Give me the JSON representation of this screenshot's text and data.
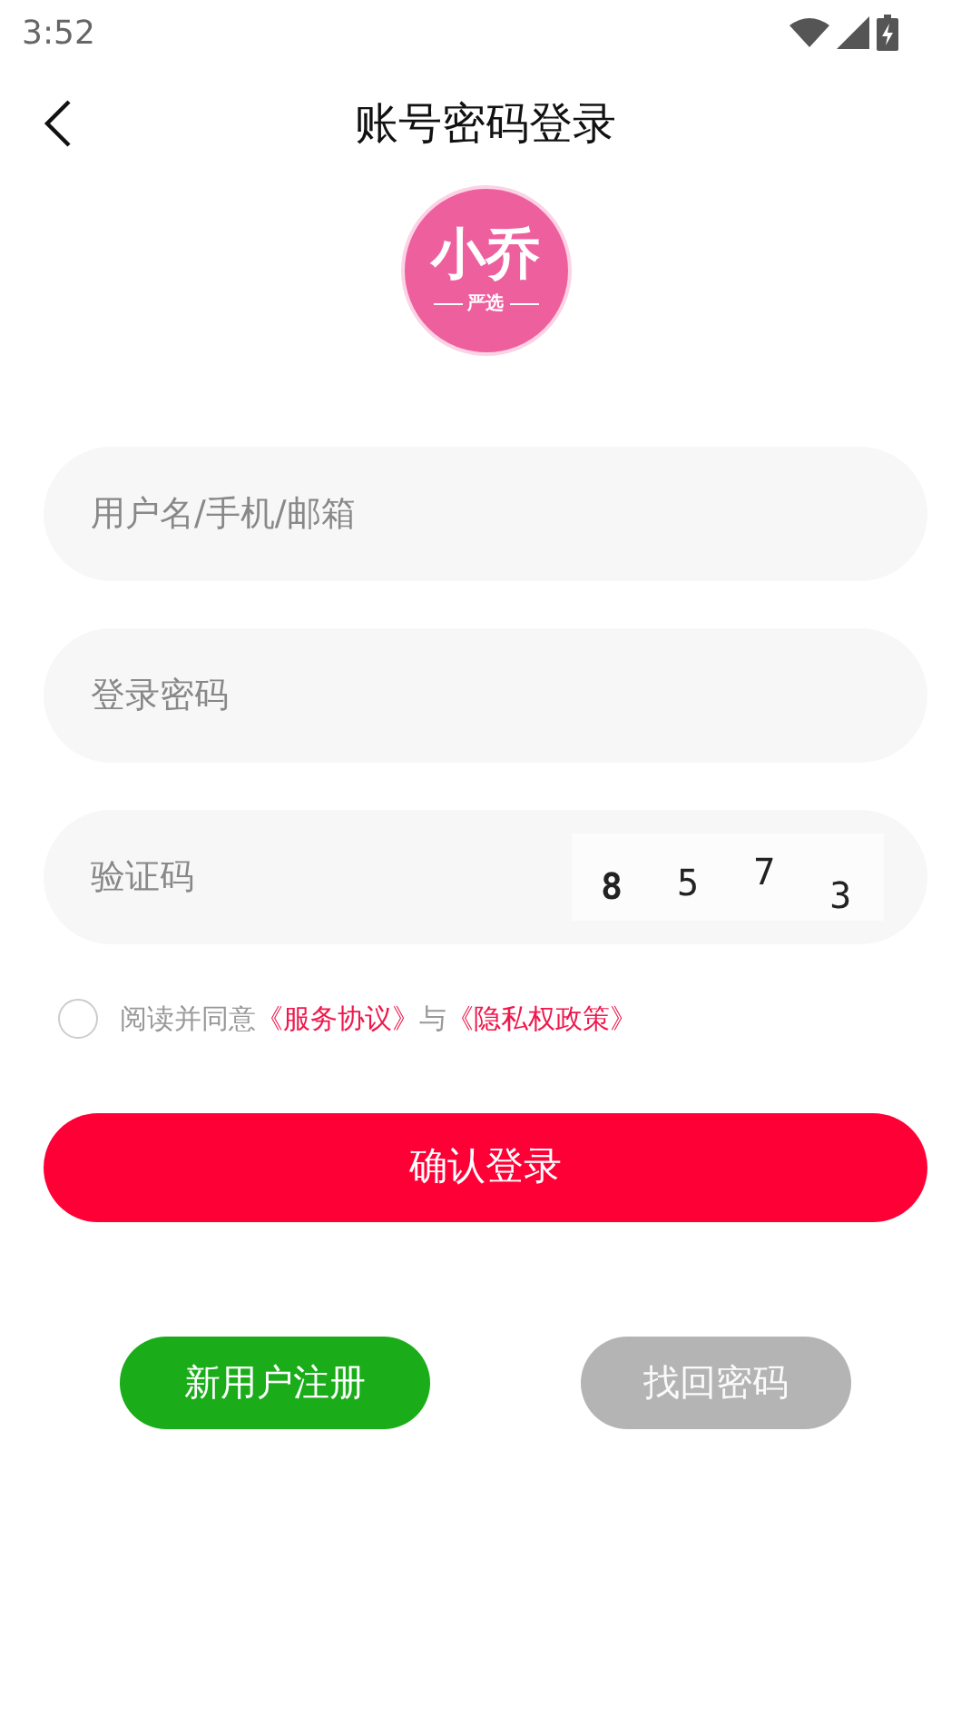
{
  "status_bar": {
    "time": "3:52"
  },
  "header": {
    "title": "账号密码登录"
  },
  "logo": {
    "name": "小乔",
    "subtitle": "严选"
  },
  "fields": [
    {
      "kind": "text",
      "placeholder": "用户名/手机/邮箱"
    },
    {
      "kind": "text",
      "placeholder": "登录密码"
    },
    {
      "kind": "captcha",
      "placeholder": "验证码",
      "captcha": [
        "8",
        "5",
        "7",
        "3"
      ]
    }
  ],
  "agreement": {
    "checked": false,
    "text": "阅读并同意",
    "link_1": "《服务协议》",
    "joiner": "与",
    "link_2": "《隐私权政策》"
  },
  "login_button": "确认登录",
  "register_button": {
    "label": "新用户注册",
    "disabled": false
  },
  "recover_button": {
    "label": "找回密码",
    "disabled": true
  }
}
